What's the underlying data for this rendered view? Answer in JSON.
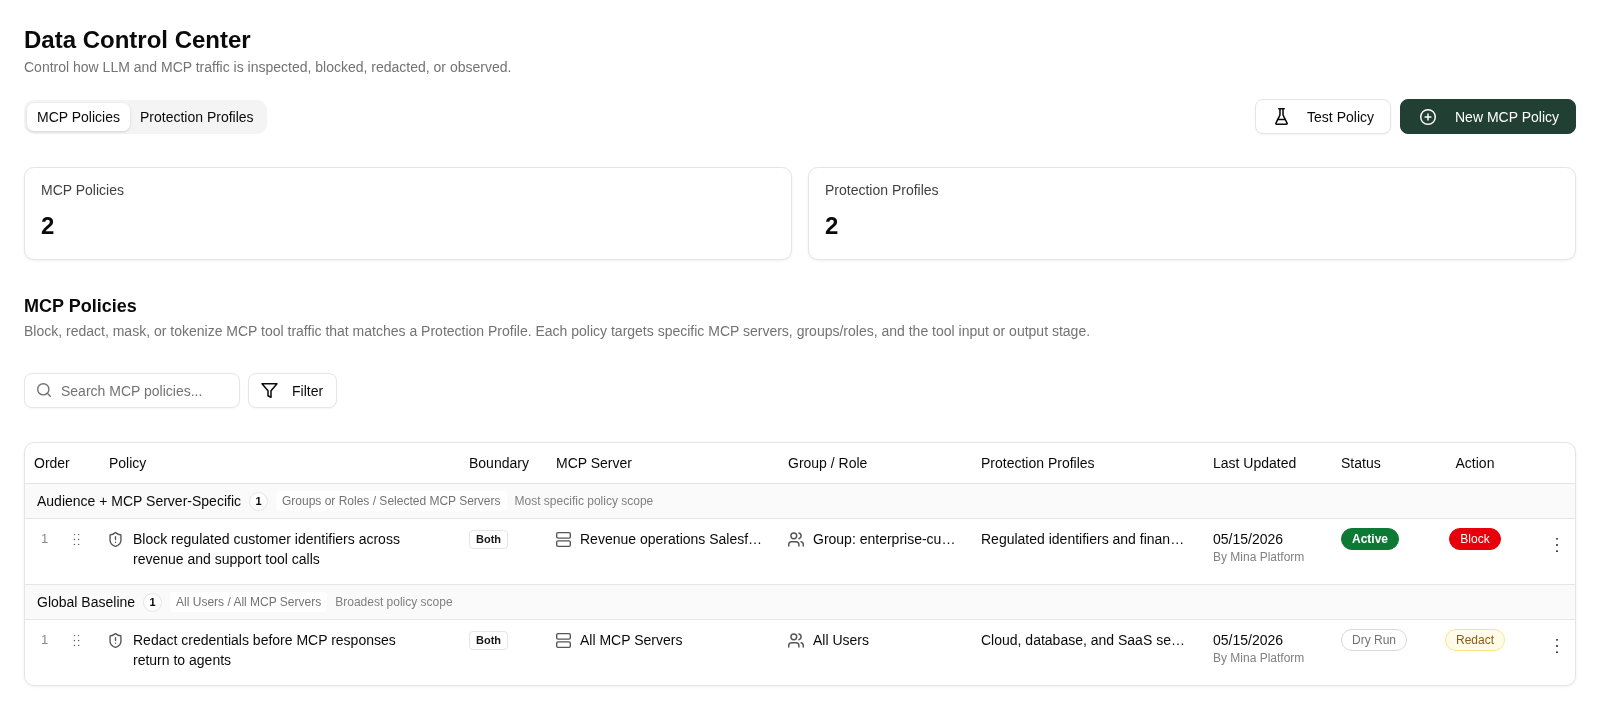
{
  "header": {
    "title": "Data Control Center",
    "subtitle": "Control how LLM and MCP traffic is inspected, blocked, redacted, or observed."
  },
  "tabs": [
    {
      "label": "MCP Policies",
      "selected": true
    },
    {
      "label": "Protection Profiles",
      "selected": false
    }
  ],
  "actions": [
    {
      "label": "Test Policy",
      "kind": "test"
    },
    {
      "label": "New MCP Policy",
      "kind": "create"
    }
  ],
  "stats": [
    {
      "label": "MCP Policies",
      "value": "2"
    },
    {
      "label": "Protection Profiles",
      "value": "2"
    }
  ],
  "section": {
    "title": "MCP Policies",
    "description": "Block, redact, mask, or tokenize MCP tool traffic that matches a Protection Profile. Each policy targets specific MCP servers, groups/roles, and the tool input or output stage."
  },
  "search": {
    "placeholder": "Search MCP policies..."
  },
  "filter_button": {
    "label": "Filter"
  },
  "table": {
    "columns": [
      "Order",
      "Policy",
      "Boundary",
      "MCP Server",
      "Group / Role",
      "Protection Profiles",
      "Last Updated",
      "Status",
      "Action"
    ],
    "groups": [
      {
        "name": "Audience + MCP Server-Specific",
        "count": "1",
        "scope": "Groups or Roles / Selected MCP Servers",
        "note": "Most specific policy scope",
        "rows": [
          {
            "order": "1",
            "policy": "Block regulated customer identifiers across revenue and support tool calls",
            "boundary": "Both",
            "mcp_server": "Revenue operations Salesf…",
            "group_role": "Group: enterprise-cu…",
            "protection_profiles": "Regulated identifiers and finan…",
            "last_updated": "05/15/2026",
            "updated_by": "By Mina Platform",
            "status": {
              "label": "Active",
              "kind": "active"
            },
            "action": {
              "label": "Block",
              "kind": "block"
            }
          }
        ]
      },
      {
        "name": "Global Baseline",
        "count": "1",
        "scope": "All Users / All MCP Servers",
        "note": "Broadest policy scope",
        "rows": [
          {
            "order": "1",
            "policy": "Redact credentials before MCP responses return to agents",
            "boundary": "Both",
            "mcp_server": "All MCP Servers",
            "group_role": "All Users",
            "protection_profiles": "Cloud, database, and SaaS se…",
            "last_updated": "05/15/2026",
            "updated_by": "By Mina Platform",
            "status": {
              "label": "Dry Run",
              "kind": "dry_run"
            },
            "action": {
              "label": "Redact",
              "kind": "redact"
            }
          }
        ]
      }
    ]
  }
}
